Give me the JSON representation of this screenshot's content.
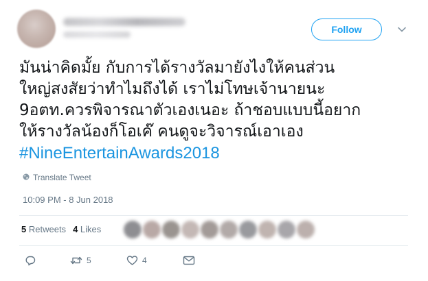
{
  "header": {
    "follow_label": "Follow"
  },
  "tweet": {
    "lines": [
      "มันน่าคิดมั้ย กับการได้รางวัลมายังไงให้คนส่วน",
      "ใหญ่สงสัยว่าทำไมถึงได้ เราไม่โทษเจ้านายนะ",
      "9อตท.ควรพิจารณาตัวเองเนอะ ถ้าชอบแบบนี้อยาก",
      "ให้รางวัลน้องก็โอเค๊ คนดูจะวิจารณ์เอาเอง"
    ],
    "hashtag": "#NineEntertainAwards2018",
    "translate_label": "Translate Tweet",
    "timestamp": "10:09 PM - 8 Jun 2018"
  },
  "stats": {
    "retweets_count": "5",
    "retweets_label": "Retweets",
    "likes_count": "4",
    "likes_label": "Likes"
  },
  "actions": {
    "retweet_count": "5",
    "like_count": "4"
  },
  "colors": {
    "accent": "#1da1f2",
    "hashtag": "#1b95e0",
    "secondary_text": "#657786",
    "divider": "#e6ecf0"
  },
  "icons": [
    "globe-icon",
    "chevron-down-icon",
    "reply-icon",
    "retweet-icon",
    "heart-icon",
    "message-icon"
  ]
}
